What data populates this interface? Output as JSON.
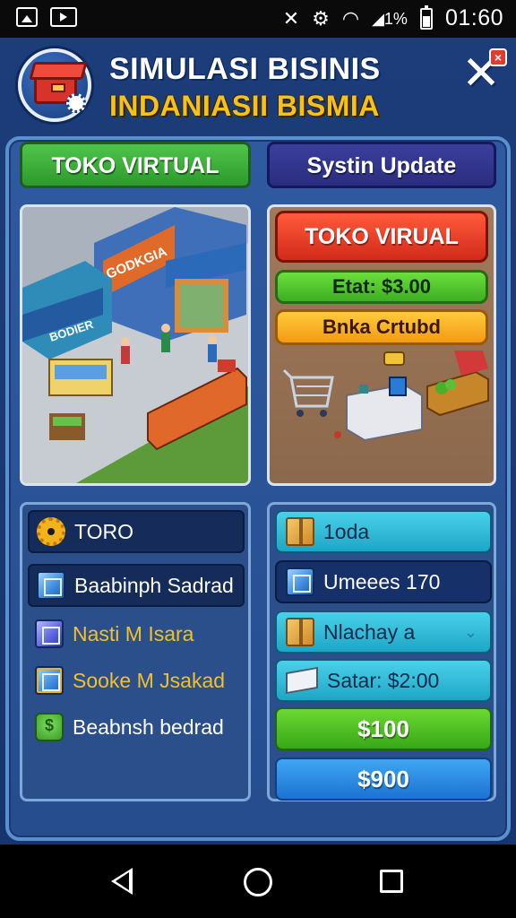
{
  "status_bar": {
    "time": "01:60",
    "battery_text": "1%"
  },
  "header": {
    "title": "SIMULASI BISINIS",
    "subtitle": "INDANIASII BISMIA"
  },
  "tabs": {
    "left": "TOKO VIRTUAL",
    "right": "Systin Update"
  },
  "scene": {
    "sign_top": "GODKGIA",
    "sign_left": "BODIER"
  },
  "info_panel": {
    "title": "TOKO VIRUAL",
    "stat": "Etat: $3.00",
    "action": "Bnka Crtubd"
  },
  "menu_list": [
    {
      "label": "TORO",
      "icon": "gear-icon",
      "style": "dark"
    },
    {
      "label": "Baabinph Sadrad",
      "icon": "cube-icon",
      "style": "dark"
    },
    {
      "label": "Nasti M Isara",
      "icon": "cube-icon",
      "style": "plain-yellow"
    },
    {
      "label": "Sooke M Jsakad",
      "icon": "cube-icon",
      "style": "plain-yellow"
    },
    {
      "label": "Beabnsh bedrad",
      "icon": "money-bag-icon",
      "style": "plain"
    }
  ],
  "stats_list": [
    {
      "label": "1oda",
      "icon": "box-icon"
    },
    {
      "label": "Umeees 170",
      "icon": "cube-icon"
    },
    {
      "label": "Nlachay a",
      "icon": "box-icon"
    },
    {
      "label": "Satar: $2:00",
      "icon": "cash-icon"
    }
  ],
  "buttons": {
    "green": "$100",
    "blue": "$900"
  },
  "colors": {
    "background": "#1d3d7a",
    "frame": "#2f5aa0",
    "accent_yellow": "#f4c21c",
    "tab_green": "#3cb23a",
    "tab_navy": "#2a2d7e",
    "red_pill": "#e83a24",
    "lime_pill": "#52c62e",
    "orange_pill": "#f7b022"
  }
}
